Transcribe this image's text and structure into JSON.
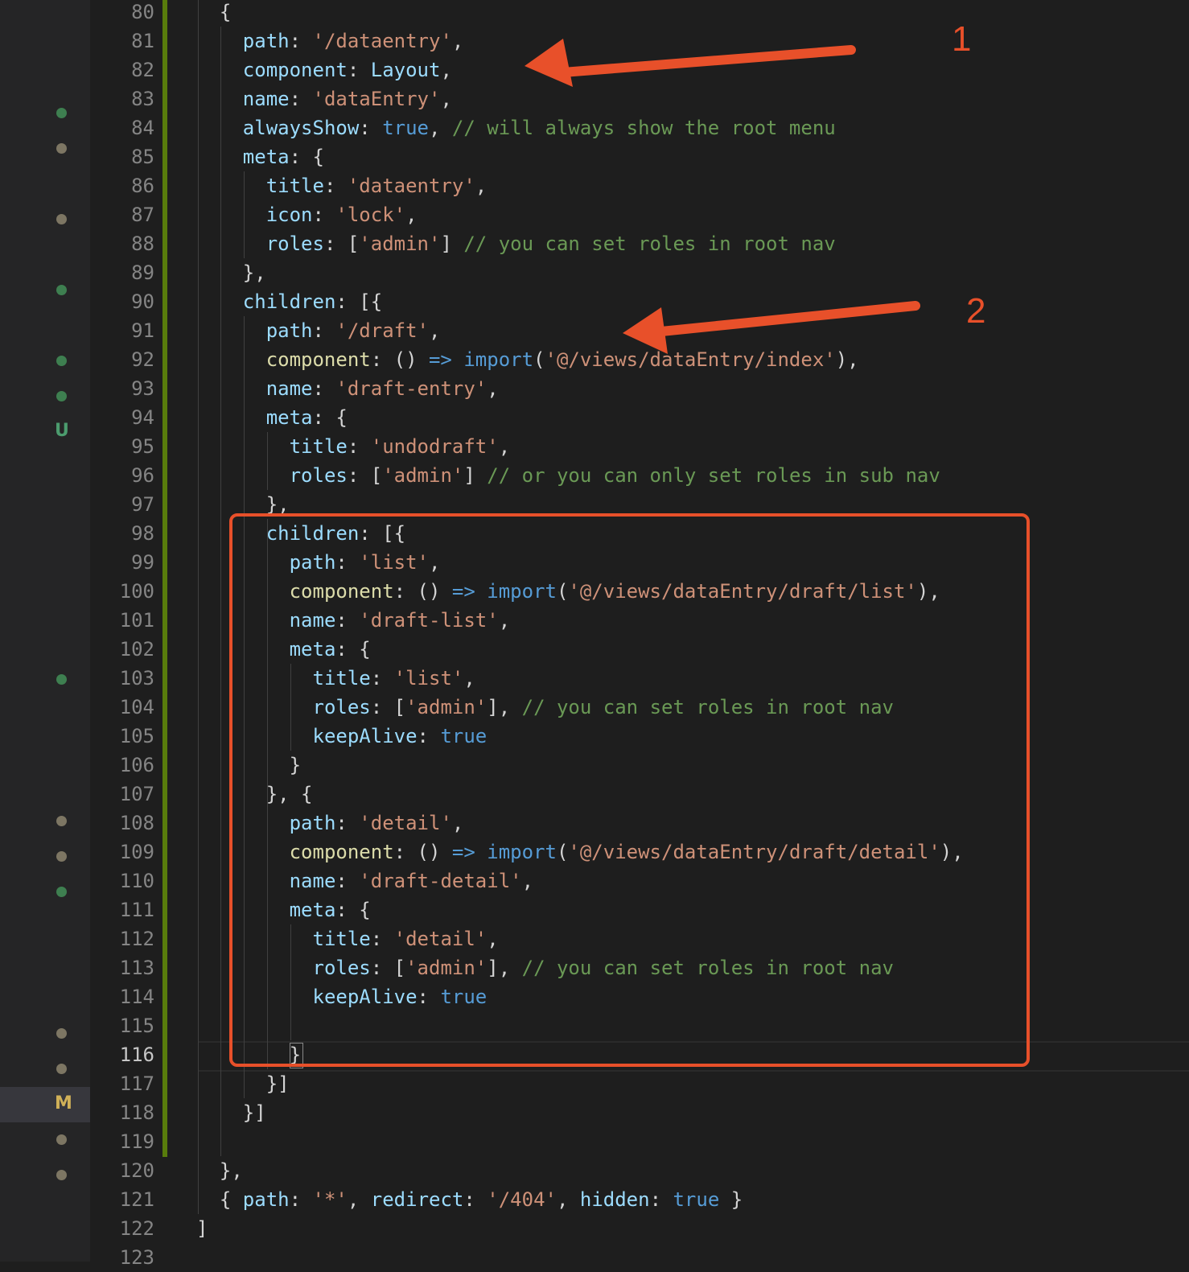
{
  "sidebar": {
    "markers": [
      {
        "kind": "dot",
        "color": "#3e7f50"
      },
      {
        "kind": "dot",
        "color": "#7d7663"
      },
      {
        "kind": "dot",
        "color": "#7d7663"
      },
      {
        "kind": "dot",
        "color": "#3e7f50"
      },
      {
        "kind": "dot",
        "color": "#3e7f50"
      },
      {
        "kind": "dot",
        "color": "#3e7f50"
      },
      {
        "kind": "letter",
        "text": "U",
        "color": "#4c9c6e"
      },
      {
        "kind": "dot",
        "color": "#3e7f50"
      },
      {
        "kind": "dot",
        "color": "#7d7663"
      },
      {
        "kind": "dot",
        "color": "#7d7663"
      },
      {
        "kind": "dot",
        "color": "#3e7f50"
      },
      {
        "kind": "dot",
        "color": "#7d7663"
      },
      {
        "kind": "dot",
        "color": "#7d7663"
      },
      {
        "kind": "letter",
        "text": "M",
        "color": "#d0b058",
        "active": true
      },
      {
        "kind": "dot",
        "color": "#7d7663"
      },
      {
        "kind": "dot",
        "color": "#7d7663"
      }
    ]
  },
  "editor": {
    "current_line": "116",
    "lines": [
      {
        "n": "80",
        "indent": 1,
        "tokens": [
          [
            "p",
            "{"
          ]
        ]
      },
      {
        "n": "81",
        "indent": 2,
        "tokens": [
          [
            "key",
            "path"
          ],
          [
            "p",
            ": "
          ],
          [
            "str",
            "'/dataentry'"
          ],
          [
            "p",
            ","
          ]
        ]
      },
      {
        "n": "82",
        "indent": 2,
        "tokens": [
          [
            "key",
            "component"
          ],
          [
            "p",
            ": "
          ],
          [
            "key",
            "Layout"
          ],
          [
            "p",
            ","
          ]
        ]
      },
      {
        "n": "83",
        "indent": 2,
        "tokens": [
          [
            "key",
            "name"
          ],
          [
            "p",
            ": "
          ],
          [
            "str",
            "'dataEntry'"
          ],
          [
            "p",
            ","
          ]
        ]
      },
      {
        "n": "84",
        "indent": 2,
        "tokens": [
          [
            "key",
            "alwaysShow"
          ],
          [
            "p",
            ": "
          ],
          [
            "kw",
            "true"
          ],
          [
            "p",
            ", "
          ],
          [
            "com",
            "// will always show the root menu"
          ]
        ]
      },
      {
        "n": "85",
        "indent": 2,
        "tokens": [
          [
            "key",
            "meta"
          ],
          [
            "p",
            ": {"
          ]
        ]
      },
      {
        "n": "86",
        "indent": 3,
        "tokens": [
          [
            "key",
            "title"
          ],
          [
            "p",
            ": "
          ],
          [
            "str",
            "'dataentry'"
          ],
          [
            "p",
            ","
          ]
        ]
      },
      {
        "n": "87",
        "indent": 3,
        "tokens": [
          [
            "key",
            "icon"
          ],
          [
            "p",
            ": "
          ],
          [
            "str",
            "'lock'"
          ],
          [
            "p",
            ","
          ]
        ]
      },
      {
        "n": "88",
        "indent": 3,
        "tokens": [
          [
            "key",
            "roles"
          ],
          [
            "p",
            ": ["
          ],
          [
            "str",
            "'admin'"
          ],
          [
            "p",
            "] "
          ],
          [
            "com",
            "// you can set roles in root nav"
          ]
        ]
      },
      {
        "n": "89",
        "indent": 2,
        "tokens": [
          [
            "p",
            "},"
          ]
        ]
      },
      {
        "n": "90",
        "indent": 2,
        "tokens": [
          [
            "key",
            "children"
          ],
          [
            "p",
            ": [{"
          ]
        ]
      },
      {
        "n": "91",
        "indent": 3,
        "tokens": [
          [
            "key",
            "path"
          ],
          [
            "p",
            ": "
          ],
          [
            "str",
            "'/draft'"
          ],
          [
            "p",
            ","
          ]
        ]
      },
      {
        "n": "92",
        "indent": 3,
        "tokens": [
          [
            "fn",
            "component"
          ],
          [
            "p",
            ": () "
          ],
          [
            "kw",
            "=>"
          ],
          [
            "p",
            " "
          ],
          [
            "kw",
            "import"
          ],
          [
            "p",
            "("
          ],
          [
            "str",
            "'@/views/dataEntry/index'"
          ],
          [
            "p",
            "),"
          ]
        ]
      },
      {
        "n": "93",
        "indent": 3,
        "tokens": [
          [
            "key",
            "name"
          ],
          [
            "p",
            ": "
          ],
          [
            "str",
            "'draft-entry'"
          ],
          [
            "p",
            ","
          ]
        ]
      },
      {
        "n": "94",
        "indent": 3,
        "tokens": [
          [
            "key",
            "meta"
          ],
          [
            "p",
            ": {"
          ]
        ]
      },
      {
        "n": "95",
        "indent": 4,
        "tokens": [
          [
            "key",
            "title"
          ],
          [
            "p",
            ": "
          ],
          [
            "str",
            "'undodraft'"
          ],
          [
            "p",
            ","
          ]
        ]
      },
      {
        "n": "96",
        "indent": 4,
        "tokens": [
          [
            "key",
            "roles"
          ],
          [
            "p",
            ": ["
          ],
          [
            "str",
            "'admin'"
          ],
          [
            "p",
            "] "
          ],
          [
            "com",
            "// or you can only set roles in sub nav"
          ]
        ]
      },
      {
        "n": "97",
        "indent": 3,
        "tokens": [
          [
            "p",
            "},"
          ]
        ]
      },
      {
        "n": "98",
        "indent": 3,
        "tokens": [
          [
            "key",
            "children"
          ],
          [
            "p",
            ": [{"
          ]
        ]
      },
      {
        "n": "99",
        "indent": 4,
        "tokens": [
          [
            "key",
            "path"
          ],
          [
            "p",
            ": "
          ],
          [
            "str",
            "'list'"
          ],
          [
            "p",
            ","
          ]
        ]
      },
      {
        "n": "100",
        "indent": 4,
        "tokens": [
          [
            "fn",
            "component"
          ],
          [
            "p",
            ": () "
          ],
          [
            "kw",
            "=>"
          ],
          [
            "p",
            " "
          ],
          [
            "kw",
            "import"
          ],
          [
            "p",
            "("
          ],
          [
            "str",
            "'@/views/dataEntry/draft/list'"
          ],
          [
            "p",
            "),"
          ]
        ]
      },
      {
        "n": "101",
        "indent": 4,
        "tokens": [
          [
            "key",
            "name"
          ],
          [
            "p",
            ": "
          ],
          [
            "str",
            "'draft-list'"
          ],
          [
            "p",
            ","
          ]
        ]
      },
      {
        "n": "102",
        "indent": 4,
        "tokens": [
          [
            "key",
            "meta"
          ],
          [
            "p",
            ": {"
          ]
        ]
      },
      {
        "n": "103",
        "indent": 5,
        "tokens": [
          [
            "key",
            "title"
          ],
          [
            "p",
            ": "
          ],
          [
            "str",
            "'list'"
          ],
          [
            "p",
            ","
          ]
        ]
      },
      {
        "n": "104",
        "indent": 5,
        "tokens": [
          [
            "key",
            "roles"
          ],
          [
            "p",
            ": ["
          ],
          [
            "str",
            "'admin'"
          ],
          [
            "p",
            "], "
          ],
          [
            "com",
            "// you can set roles in root nav"
          ]
        ]
      },
      {
        "n": "105",
        "indent": 5,
        "tokens": [
          [
            "key",
            "keepAlive"
          ],
          [
            "p",
            ": "
          ],
          [
            "kw",
            "true"
          ]
        ]
      },
      {
        "n": "106",
        "indent": 4,
        "tokens": [
          [
            "p",
            "}"
          ]
        ]
      },
      {
        "n": "107",
        "indent": 3,
        "tokens": [
          [
            "p",
            "}, {"
          ]
        ]
      },
      {
        "n": "108",
        "indent": 4,
        "tokens": [
          [
            "key",
            "path"
          ],
          [
            "p",
            ": "
          ],
          [
            "str",
            "'detail'"
          ],
          [
            "p",
            ","
          ]
        ]
      },
      {
        "n": "109",
        "indent": 4,
        "tokens": [
          [
            "fn",
            "component"
          ],
          [
            "p",
            ": () "
          ],
          [
            "kw",
            "=>"
          ],
          [
            "p",
            " "
          ],
          [
            "kw",
            "import"
          ],
          [
            "p",
            "("
          ],
          [
            "str",
            "'@/views/dataEntry/draft/detail'"
          ],
          [
            "p",
            "),"
          ]
        ]
      },
      {
        "n": "110",
        "indent": 4,
        "tokens": [
          [
            "key",
            "name"
          ],
          [
            "p",
            ": "
          ],
          [
            "str",
            "'draft-detail'"
          ],
          [
            "p",
            ","
          ]
        ]
      },
      {
        "n": "111",
        "indent": 4,
        "tokens": [
          [
            "key",
            "meta"
          ],
          [
            "p",
            ": {"
          ]
        ]
      },
      {
        "n": "112",
        "indent": 5,
        "tokens": [
          [
            "key",
            "title"
          ],
          [
            "p",
            ": "
          ],
          [
            "str",
            "'detail'"
          ],
          [
            "p",
            ","
          ]
        ]
      },
      {
        "n": "113",
        "indent": 5,
        "tokens": [
          [
            "key",
            "roles"
          ],
          [
            "p",
            ": ["
          ],
          [
            "str",
            "'admin'"
          ],
          [
            "p",
            "], "
          ],
          [
            "com",
            "// you can set roles in root nav"
          ]
        ]
      },
      {
        "n": "114",
        "indent": 5,
        "tokens": [
          [
            "key",
            "keepAlive"
          ],
          [
            "p",
            ": "
          ],
          [
            "kw",
            "true"
          ]
        ]
      },
      {
        "n": "115",
        "indent": 0,
        "tokens": []
      },
      {
        "n": "116",
        "indent": 4,
        "tokens": [
          [
            "p",
            "}"
          ]
        ]
      },
      {
        "n": "117",
        "indent": 3,
        "tokens": [
          [
            "p",
            "}]"
          ]
        ]
      },
      {
        "n": "118",
        "indent": 2,
        "tokens": [
          [
            "p",
            "}]"
          ]
        ]
      },
      {
        "n": "119",
        "indent": 0,
        "tokens": []
      },
      {
        "n": "120",
        "indent": 1,
        "tokens": [
          [
            "p",
            "},"
          ]
        ]
      },
      {
        "n": "121",
        "indent": 1,
        "tokens": [
          [
            "p",
            "{ "
          ],
          [
            "key",
            "path"
          ],
          [
            "p",
            ": "
          ],
          [
            "str",
            "'*'"
          ],
          [
            "p",
            ", "
          ],
          [
            "key",
            "redirect"
          ],
          [
            "p",
            ": "
          ],
          [
            "str",
            "'/404'"
          ],
          [
            "p",
            ", "
          ],
          [
            "key",
            "hidden"
          ],
          [
            "p",
            ": "
          ],
          [
            "kw",
            "true"
          ],
          [
            "p",
            " }"
          ]
        ]
      },
      {
        "n": "122",
        "indent": 0,
        "tokens": [
          [
            "p",
            "]"
          ]
        ]
      },
      {
        "n": "123",
        "indent": 0,
        "tokens": []
      }
    ]
  },
  "annotations": {
    "color": "#e8502a",
    "arrow_1_label": "1",
    "arrow_2_label": "2",
    "highlight_box_lines": "98-116"
  }
}
